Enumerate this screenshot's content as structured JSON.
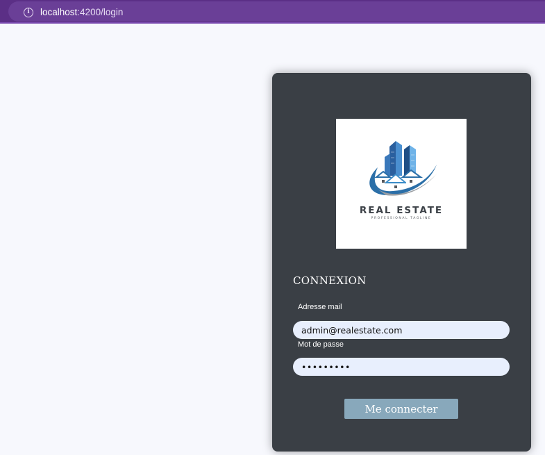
{
  "browser": {
    "url_host": "localhost",
    "url_path": ":4200/login"
  },
  "logo": {
    "title": "REAL ESTATE",
    "tagline": "PROFESSIONAL TAGLINE"
  },
  "login": {
    "heading": "CONNEXION",
    "email_label": "Adresse mail",
    "email_value": "admin@realestate.com",
    "password_label": "Mot de passe",
    "password_value": "•••••••••",
    "submit_label": "Me connecter"
  },
  "colors": {
    "browser_bar": "#5b2f86",
    "card": "#3a3f45",
    "button": "#88a8bb",
    "input": "#e8effd"
  }
}
